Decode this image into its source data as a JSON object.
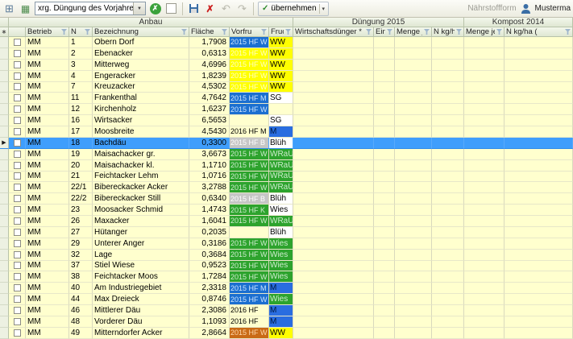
{
  "icons": {
    "window": "⊞",
    "table": "▦",
    "combo_dropdown": "▼",
    "circle_x": "✗",
    "delete_x": "✗",
    "undo": "↶",
    "redo": "↷",
    "check": "✓",
    "menu_arrow": "▾",
    "row_marker": "▶",
    "selector_header": "∗"
  },
  "toolbar": {
    "combo_value": "xrg. Düngung des Vorjahres",
    "apply_button": "übernehmen",
    "nahrstoffform_label": "Nährstoffform",
    "user_label": "Musterma"
  },
  "grid": {
    "group_headers": [
      "Anbau",
      "Düngung 2015",
      "Kompost 2014"
    ],
    "columns": [
      "Betrieb",
      "N",
      "Bezeichnung",
      "Fläche",
      "Vorfru",
      "Frucht",
      "Wirtschaftsdünger *",
      "Einh",
      "Menge je",
      "N kg/ha (",
      "Menge je",
      "N kg/ha ("
    ],
    "selected_row_number": "18",
    "chip_colors": {
      "blue": {
        "bg": "#1b6fd0",
        "fg": "#cfe6ff"
      },
      "blue_m": {
        "bg": "#2a6de0",
        "fg": "#001a40"
      },
      "yellow_soft": {
        "bg": "#ffff00",
        "fg": "#ffffc4"
      },
      "yellow": {
        "bg": "#ffff00",
        "fg": "#000000"
      },
      "green": {
        "bg": "#2da32d",
        "fg": "#cdeccd"
      },
      "gray": {
        "bg": "#c6c6c6",
        "fg": "#ffffff"
      },
      "orange": {
        "bg": "#c96a16",
        "fg": "#ffd9ae"
      },
      "white": {
        "bg": "#ffffff",
        "fg": "#000000"
      },
      "plain": {
        "bg": "",
        "fg": "#000000"
      }
    },
    "rows": [
      {
        "betrieb": "MM",
        "nr": "1",
        "name": "Obern Dorf",
        "flaeche": "1,7908",
        "vorfru": {
          "text": "2015 HF W",
          "color": "blue"
        },
        "frucht": {
          "text": "WW",
          "color": "yellow"
        },
        "selected": false
      },
      {
        "betrieb": "MM",
        "nr": "2",
        "name": "Ebenacker",
        "flaeche": "0,6313",
        "vorfru": {
          "text": "2015 HF W",
          "color": "yellow_soft"
        },
        "frucht": {
          "text": "WW",
          "color": "yellow"
        },
        "selected": false
      },
      {
        "betrieb": "MM",
        "nr": "3",
        "name": "Mitterweg",
        "flaeche": "4,6996",
        "vorfru": {
          "text": "2015 HF W",
          "color": "yellow_soft"
        },
        "frucht": {
          "text": "WW",
          "color": "yellow"
        },
        "selected": false
      },
      {
        "betrieb": "MM",
        "nr": "4",
        "name": "Engeracker",
        "flaeche": "1,8239",
        "vorfru": {
          "text": "2015 HF W",
          "color": "yellow_soft"
        },
        "frucht": {
          "text": "WW",
          "color": "yellow"
        },
        "selected": false
      },
      {
        "betrieb": "MM",
        "nr": "7",
        "name": "Kreuzacker",
        "flaeche": "4,5302",
        "vorfru": {
          "text": "2015 HF W",
          "color": "yellow_soft"
        },
        "frucht": {
          "text": "WW",
          "color": "yellow"
        },
        "selected": false
      },
      {
        "betrieb": "MM",
        "nr": "11",
        "name": "Frankenthal",
        "flaeche": "4,7642",
        "vorfru": {
          "text": "2015 HF M",
          "color": "blue"
        },
        "frucht": {
          "text": "SG",
          "color": "white"
        },
        "selected": false
      },
      {
        "betrieb": "MM",
        "nr": "12",
        "name": "Kirchenholz",
        "flaeche": "1,6237",
        "vorfru": {
          "text": "2015 HF W",
          "color": "blue"
        },
        "frucht": {
          "text": "",
          "color": "plain"
        },
        "selected": false
      },
      {
        "betrieb": "MM",
        "nr": "16",
        "name": "Wirtsacker",
        "flaeche": "6,5653",
        "vorfru": {
          "text": "",
          "color": "plain"
        },
        "frucht": {
          "text": "SG",
          "color": "white"
        },
        "selected": false
      },
      {
        "betrieb": "MM",
        "nr": "17",
        "name": "Moosbreite",
        "flaeche": "4,5430",
        "vorfru": {
          "text": "2016 HF M",
          "color": "plain"
        },
        "frucht": {
          "text": "M",
          "color": "blue_m"
        },
        "selected": false
      },
      {
        "betrieb": "MM",
        "nr": "18",
        "name": "Bachdäu",
        "flaeche": "0,3300",
        "vorfru": {
          "text": "2015 HF B",
          "color": "gray"
        },
        "frucht": {
          "text": "Blüh",
          "color": "white"
        },
        "selected": true
      },
      {
        "betrieb": "MM",
        "nr": "19",
        "name": "Maisachacker gr.",
        "flaeche": "3,6673",
        "vorfru": {
          "text": "2015 HF W",
          "color": "green"
        },
        "frucht": {
          "text": "WRaU",
          "color": "green"
        },
        "selected": false
      },
      {
        "betrieb": "MM",
        "nr": "20",
        "name": "Maisachacker kl.",
        "flaeche": "1,1710",
        "vorfru": {
          "text": "2015 HF W",
          "color": "green"
        },
        "frucht": {
          "text": "WRaU",
          "color": "green"
        },
        "selected": false
      },
      {
        "betrieb": "MM",
        "nr": "21",
        "name": "Feichtacker Lehm",
        "flaeche": "1,0716",
        "vorfru": {
          "text": "2015 HF W",
          "color": "green"
        },
        "frucht": {
          "text": "WRaU",
          "color": "green"
        },
        "selected": false
      },
      {
        "betrieb": "MM",
        "nr": "22/1",
        "name": "Bibereckacker Acker",
        "flaeche": "3,2788",
        "vorfru": {
          "text": "2015 HF W",
          "color": "green"
        },
        "frucht": {
          "text": "WRaU",
          "color": "green"
        },
        "selected": false
      },
      {
        "betrieb": "MM",
        "nr": "22/2",
        "name": "Bibereckacker Still",
        "flaeche": "0,6340",
        "vorfru": {
          "text": "2015 HF B",
          "color": "gray"
        },
        "frucht": {
          "text": "Blüh",
          "color": "white"
        },
        "selected": false
      },
      {
        "betrieb": "MM",
        "nr": "23",
        "name": "Moosacker Schmid",
        "flaeche": "1,4743",
        "vorfru": {
          "text": "2015 HF K",
          "color": "green"
        },
        "frucht": {
          "text": "Wies",
          "color": "white"
        },
        "selected": false
      },
      {
        "betrieb": "MM",
        "nr": "26",
        "name": "Maxacker",
        "flaeche": "1,6041",
        "vorfru": {
          "text": "2015 HF W",
          "color": "green"
        },
        "frucht": {
          "text": "WRaU",
          "color": "green"
        },
        "selected": false
      },
      {
        "betrieb": "MM",
        "nr": "27",
        "name": "Hütanger",
        "flaeche": "0,2035",
        "vorfru": {
          "text": "",
          "color": "plain"
        },
        "frucht": {
          "text": "Blüh",
          "color": "white"
        },
        "selected": false
      },
      {
        "betrieb": "MM",
        "nr": "29",
        "name": "Unterer Anger",
        "flaeche": "0,3186",
        "vorfru": {
          "text": "2015 HF W",
          "color": "green"
        },
        "frucht": {
          "text": "Wies",
          "color": "green"
        },
        "selected": false
      },
      {
        "betrieb": "MM",
        "nr": "32",
        "name": "Lage",
        "flaeche": "0,3684",
        "vorfru": {
          "text": "2015 HF W",
          "color": "green"
        },
        "frucht": {
          "text": "Wies",
          "color": "green"
        },
        "selected": false
      },
      {
        "betrieb": "MM",
        "nr": "37",
        "name": "Stiel Wiese",
        "flaeche": "0,9523",
        "vorfru": {
          "text": "2015 HF W",
          "color": "green"
        },
        "frucht": {
          "text": "Wies",
          "color": "green"
        },
        "selected": false
      },
      {
        "betrieb": "MM",
        "nr": "38",
        "name": "Feichtacker Moos",
        "flaeche": "1,7284",
        "vorfru": {
          "text": "2015 HF W",
          "color": "green"
        },
        "frucht": {
          "text": "Wies",
          "color": "green"
        },
        "selected": false
      },
      {
        "betrieb": "MM",
        "nr": "40",
        "name": "Am Industriegebiet",
        "flaeche": "2,3318",
        "vorfru": {
          "text": "2015 HF M",
          "color": "blue"
        },
        "frucht": {
          "text": "M",
          "color": "blue_m"
        },
        "selected": false
      },
      {
        "betrieb": "MM",
        "nr": "44",
        "name": "Max Dreieck",
        "flaeche": "0,8746",
        "vorfru": {
          "text": "2015 HF W",
          "color": "blue"
        },
        "frucht": {
          "text": "Wies",
          "color": "green"
        },
        "selected": false
      },
      {
        "betrieb": "MM",
        "nr": "46",
        "name": "Mittlerer Däu",
        "flaeche": "2,3086",
        "vorfru": {
          "text": "2016 HF",
          "color": "plain"
        },
        "frucht": {
          "text": "M",
          "color": "blue_m"
        },
        "selected": false
      },
      {
        "betrieb": "MM",
        "nr": "48",
        "name": "Vorderer Däu",
        "flaeche": "1,1093",
        "vorfru": {
          "text": "2016 HF",
          "color": "plain"
        },
        "frucht": {
          "text": "M",
          "color": "blue_m"
        },
        "selected": false
      },
      {
        "betrieb": "MM",
        "nr": "49",
        "name": "Mitterndorfer Acker",
        "flaeche": "2,8664",
        "vorfru": {
          "text": "2015 HF W",
          "color": "orange"
        },
        "frucht": {
          "text": "WW",
          "color": "yellow"
        },
        "selected": false
      }
    ]
  }
}
